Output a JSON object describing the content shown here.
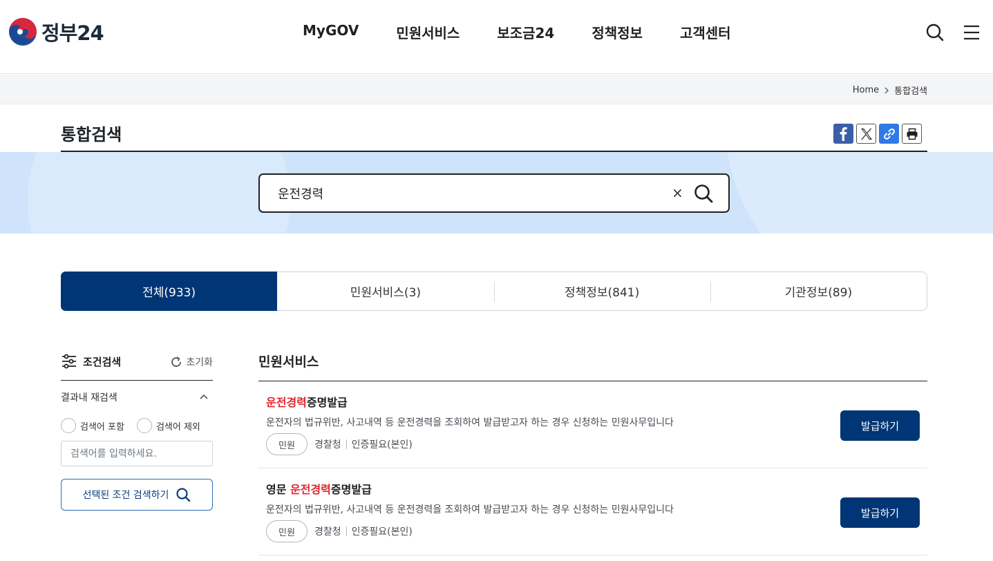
{
  "header": {
    "logo_text": "정부24",
    "nav": [
      "MyGOV",
      "민원서비스",
      "보조금24",
      "정책정보",
      "고객센터"
    ],
    "icons": [
      "search-icon",
      "menu-icon"
    ]
  },
  "breadcrumb": {
    "home": "Home",
    "current": "통합검색"
  },
  "page": {
    "title": "통합검색",
    "share_icons": [
      "facebook-icon",
      "x-icon",
      "link-icon",
      "print-icon"
    ]
  },
  "search": {
    "value": "운전경력",
    "clear": "×"
  },
  "tabs": [
    {
      "label": "전체(933)",
      "active": true
    },
    {
      "label": "민원서비스(3)",
      "active": false
    },
    {
      "label": "정책정보(841)",
      "active": false
    },
    {
      "label": "기관정보(89)",
      "active": false
    }
  ],
  "sidebar": {
    "title": "조건검색",
    "reset": "초기화",
    "refine_title": "결과내 재검색",
    "include_label": "검색어 포함",
    "exclude_label": "검색어 제외",
    "input_placeholder": "검색어를 입력하세요.",
    "submit_label": "선택된 조건 검색하기"
  },
  "results": {
    "section_title": "민원서비스",
    "items": [
      {
        "title_prefix": "",
        "title_highlight": "운전경력",
        "title_suffix": "증명발급",
        "desc": "운전자의 법규위반, 사고내역 등 운전경력을 조회하여 발급받고자 하는 경우 신청하는 민원사무입니다",
        "chip": "민원",
        "agency": "경찰청",
        "auth": "인증필요(본인)",
        "button": "발급하기"
      },
      {
        "title_prefix": "영문 ",
        "title_highlight": "운전경력",
        "title_suffix": "증명발급",
        "desc": "운전자의 법규위반, 사고내역 등 운전경력을 조회하여 발급받고자 하는 경우 신청하는 민원사무입니다",
        "chip": "민원",
        "agency": "경찰청",
        "auth": "인증필요(본인)",
        "button": "발급하기"
      }
    ]
  },
  "colors": {
    "primary": "#003675",
    "highlight": "#e0262c",
    "band": "#cfe4fb"
  }
}
